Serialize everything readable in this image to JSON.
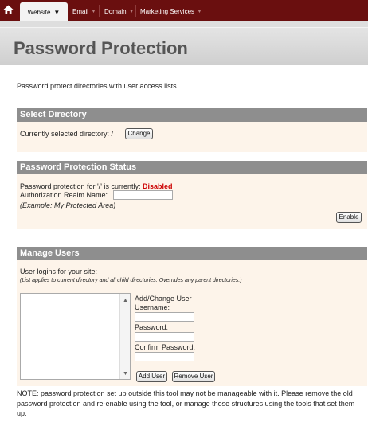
{
  "nav": {
    "tabs": [
      {
        "label": "Website",
        "caret": "▼"
      },
      {
        "label": "Email",
        "caret": "▼"
      },
      {
        "label": "Domain",
        "caret": "▼"
      },
      {
        "label": "Marketing Services",
        "caret": "▼"
      }
    ]
  },
  "page": {
    "title": "Password Protection",
    "intro": "Password protect directories with user access lists."
  },
  "select_directory": {
    "title": "Select Directory",
    "current_label": "Currently selected directory: /",
    "change_button": "Change"
  },
  "status": {
    "title": "Password Protection Status",
    "protection_label": "Password protection for '/' is currently:",
    "protection_value": "Disabled",
    "realm_label": "Authorization Realm Name:",
    "realm_value": "",
    "example": "(Example: My Protected Area)",
    "enable_button": "Enable"
  },
  "manage_users": {
    "title": "Manage Users",
    "logins_label": "User logins for your site:",
    "applies_note": "(List applies to current directory and all child directories. Overrides any parent directories.)",
    "users": [],
    "add_change_label": "Add/Change User",
    "username_label": "Username:",
    "username_value": "",
    "password_label": "Password:",
    "password_value": "",
    "confirm_label": "Confirm Password:",
    "confirm_value": "",
    "add_user_button": "Add User",
    "remove_user_button": "Remove User"
  },
  "note": "NOTE: password protection set up outside this tool may not be manageable with it. Please remove the old password protection and re-enable using the tool, or manage those structures using the tools that set them up.",
  "icons": {
    "home": "home-icon",
    "scroll_up": "▲",
    "scroll_down": "▼"
  },
  "colors": {
    "nav_bg": "#6a0f0f",
    "section_head": "#8e8e8e",
    "section_body": "#fdf4ea",
    "status_disabled": "#cc0000"
  }
}
